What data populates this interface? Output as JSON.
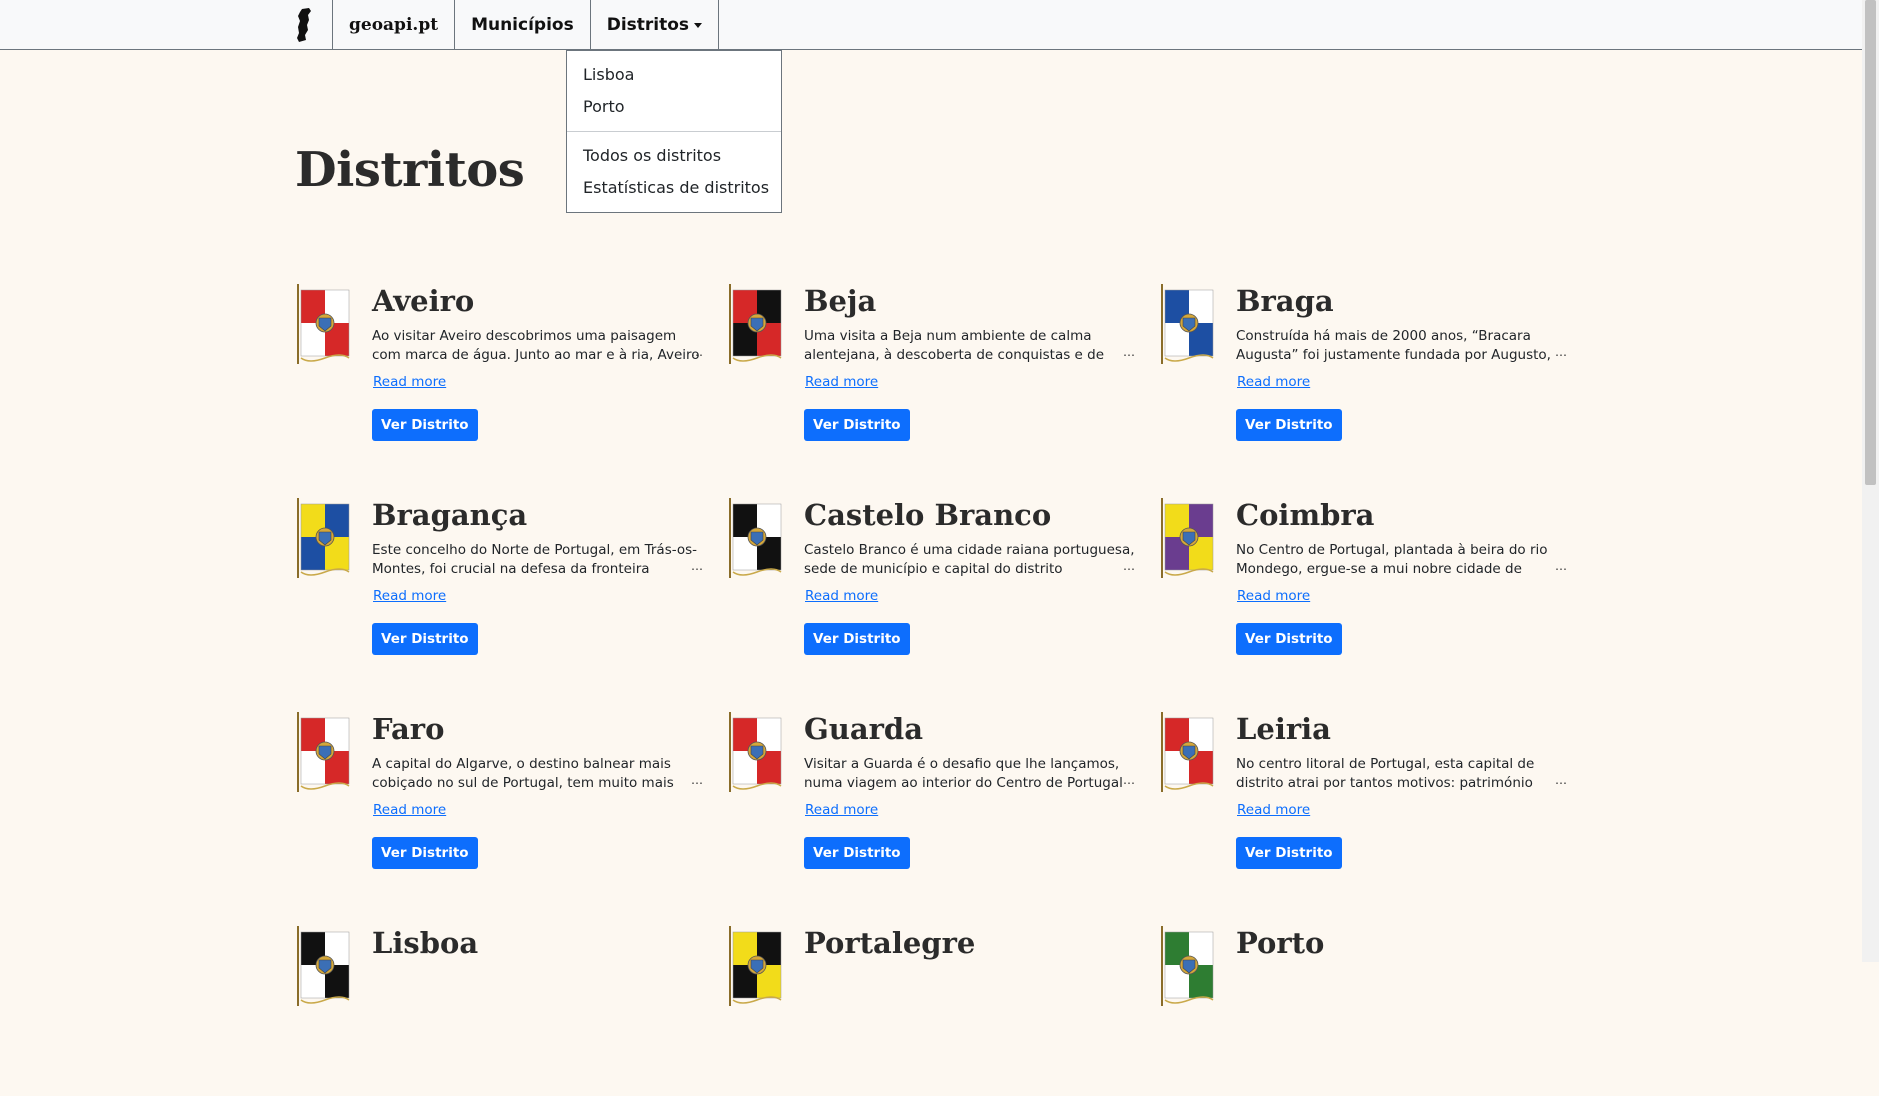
{
  "nav": {
    "brand": "geoapi.pt",
    "municipios": "Municípios",
    "distritos": "Distritos"
  },
  "dropdown": {
    "items": [
      "Lisboa",
      "Porto"
    ],
    "extra": [
      "Todos os distritos",
      "Estatísticas de distritos"
    ]
  },
  "page": {
    "title": "Distritos"
  },
  "cards": [
    {
      "name": "Aveiro",
      "text": "Ao visitar Aveiro descobrimos uma paisagem com marca de água. Junto ao mar e à ria, Aveiro é",
      "read_more": "Read more",
      "button": "Ver Distrito",
      "colors": [
        "#d62828",
        "#ffffff"
      ]
    },
    {
      "name": "Beja",
      "text": "Uma visita a Beja num ambiente de calma alentejana, à descoberta de conquistas e de",
      "read_more": "Read more",
      "button": "Ver Distrito",
      "colors": [
        "#d62828",
        "#111111"
      ]
    },
    {
      "name": "Braga",
      "text": "Construída há mais de 2000 anos, “Bracara Augusta” foi justamente fundada por Augusto,",
      "read_more": "Read more",
      "button": "Ver Distrito",
      "colors": [
        "#1d4fa3",
        "#ffffff"
      ]
    },
    {
      "name": "Bragança",
      "text": "Este concelho do Norte de Portugal, em Trás-os-Montes, foi crucial na defesa da fronteira",
      "read_more": "Read more",
      "button": "Ver Distrito",
      "colors": [
        "#f2dc1a",
        "#1d4fa3"
      ]
    },
    {
      "name": "Castelo Branco",
      "text": "Castelo Branco é uma cidade raiana portuguesa, sede de município e capital do distrito",
      "read_more": "Read more",
      "button": "Ver Distrito",
      "colors": [
        "#111111",
        "#ffffff"
      ]
    },
    {
      "name": "Coimbra",
      "text": "No Centro de Portugal, plantada à beira do rio Mondego, ergue-se a mui nobre cidade de",
      "read_more": "Read more",
      "button": "Ver Distrito",
      "colors": [
        "#f2dc1a",
        "#6a3d8f"
      ]
    },
    {
      "name": "Faro",
      "text": "A capital do Algarve, o destino balnear mais cobiçado no sul de Portugal, tem muito mais para",
      "read_more": "Read more",
      "button": "Ver Distrito",
      "colors": [
        "#d62828",
        "#ffffff"
      ]
    },
    {
      "name": "Guarda",
      "text": "Visitar a Guarda é o desafio que lhe lançamos, numa viagem ao interior do Centro de Portugal",
      "read_more": "Read more",
      "button": "Ver Distrito",
      "colors": [
        "#d62828",
        "#ffffff"
      ]
    },
    {
      "name": "Leiria",
      "text": "No centro litoral de Portugal, esta capital de distrito atrai por tantos motivos: património",
      "read_more": "Read more",
      "button": "Ver Distrito",
      "colors": [
        "#d62828",
        "#ffffff"
      ]
    },
    {
      "name": "Lisboa",
      "text": "",
      "read_more": "",
      "button": "",
      "colors": [
        "#111111",
        "#ffffff"
      ]
    },
    {
      "name": "Portalegre",
      "text": "",
      "read_more": "",
      "button": "",
      "colors": [
        "#f2dc1a",
        "#111111"
      ]
    },
    {
      "name": "Porto",
      "text": "",
      "read_more": "",
      "button": "",
      "colors": [
        "#2e7d32",
        "#ffffff"
      ]
    }
  ]
}
